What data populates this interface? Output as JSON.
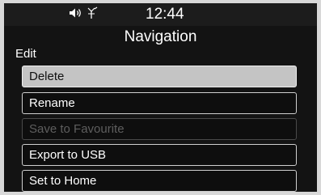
{
  "status": {
    "time": "12:44",
    "icons": [
      "speaker-volume-icon",
      "antenna-signal-icon"
    ]
  },
  "screen": {
    "title": "Navigation",
    "subtitle": "Edit"
  },
  "menu": {
    "items": [
      {
        "label": "Delete",
        "state": "selected"
      },
      {
        "label": "Rename",
        "state": "enabled"
      },
      {
        "label": "Save to Favourite",
        "state": "disabled"
      },
      {
        "label": "Export to USB",
        "state": "enabled"
      },
      {
        "label": "Set to Home",
        "state": "enabled"
      }
    ]
  },
  "colors": {
    "background": "#131313",
    "selected_fill": "#c4c4c4",
    "border": "#cfcfcf",
    "disabled_text": "#5e5e5e"
  }
}
